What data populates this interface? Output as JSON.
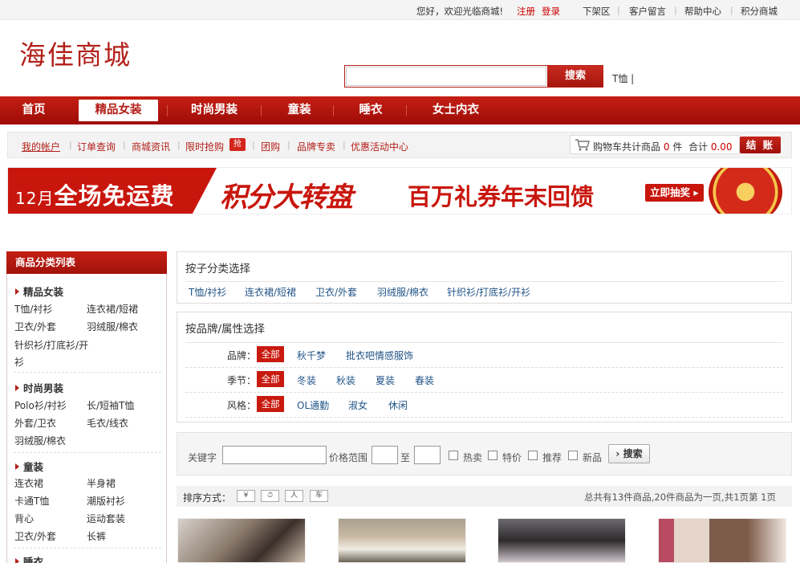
{
  "topbar": {
    "welcome": "您好，欢迎光临商城!",
    "register": "注册",
    "login": "登录",
    "links": [
      "下架区",
      "客户留言",
      "帮助中心",
      "积分商城"
    ],
    "separator": "|"
  },
  "logo": "海佳商城",
  "search": {
    "placeholder": "",
    "button": "搜索",
    "hot_keyword": "T恤 |"
  },
  "nav": {
    "items": [
      "首页",
      "精品女装",
      "时尚男装",
      "童装",
      "睡衣",
      "女士内衣"
    ],
    "active": "精品女装"
  },
  "subnav": {
    "items": [
      "我的帐户",
      "订单查询",
      "商城资讯",
      "限时抢购",
      "团购",
      "品牌专卖",
      "优惠活动中心"
    ],
    "flash_badge": "抢",
    "cart": {
      "label_prefix": "购物车共计商品",
      "count": "0",
      "count_unit": "件",
      "total_label": "合计",
      "total": "0.00",
      "checkout": "结 账"
    }
  },
  "banner": {
    "month": "12月",
    "free_shipping": "全场免运费",
    "wheel": "积分大转盘",
    "coupons": "百万礼券年末回馈",
    "cta": "立即抽奖"
  },
  "sidebar": {
    "title": "商品分类列表",
    "categories": [
      {
        "name": "精品女装",
        "items": [
          "T恤/衬衫",
          "连衣裙/短裙",
          "卫衣/外套",
          "羽绒服/棉衣",
          "针织衫/打底衫/开衫"
        ]
      },
      {
        "name": "时尚男装",
        "items": [
          "Polo衫/衬衫",
          "长/短袖T恤",
          "外套/卫衣",
          "毛衣/线衣",
          "羽绒服/棉衣"
        ]
      },
      {
        "name": "童装",
        "items": [
          "连衣裙",
          "半身裙",
          "卡通T恤",
          "潮版衬衫",
          "背心",
          "运动套装",
          "卫衣/外套",
          "长裤"
        ]
      },
      {
        "name": "睡衣",
        "items": []
      }
    ]
  },
  "subcat": {
    "title": "按子分类选择",
    "items": [
      "T恤/衬衫",
      "连衣裙/短裙",
      "卫衣/外套",
      "羽绒服/棉衣",
      "针织衫/打底衫/开衫"
    ]
  },
  "brand_filter": {
    "title": "按品牌/属性选择",
    "rows": [
      {
        "label": "品牌：",
        "all": "全部",
        "options": [
          "秋千梦",
          "批衣吧情感服饰"
        ]
      },
      {
        "label": "季节：",
        "all": "全部",
        "options": [
          "冬装",
          "秋装",
          "夏装",
          "春装"
        ]
      },
      {
        "label": "风格：",
        "all": "全部",
        "options": [
          "OL通勤",
          "淑女",
          "休闲"
        ]
      }
    ]
  },
  "keyword_search": {
    "keyword_label": "关键字",
    "price_label": "价格范围",
    "to": "至",
    "checks": [
      "热卖",
      "特价",
      "推荐",
      "新品"
    ],
    "button": "搜索"
  },
  "sort": {
    "label": "排序方式：",
    "buttons": [
      "¥",
      "⏱",
      "人",
      "车"
    ],
    "info": "总共有13件商品,20件商品为一页,共1页第  1页"
  },
  "colors": {
    "brand_red": "#b3201a",
    "link_blue": "#225588"
  }
}
